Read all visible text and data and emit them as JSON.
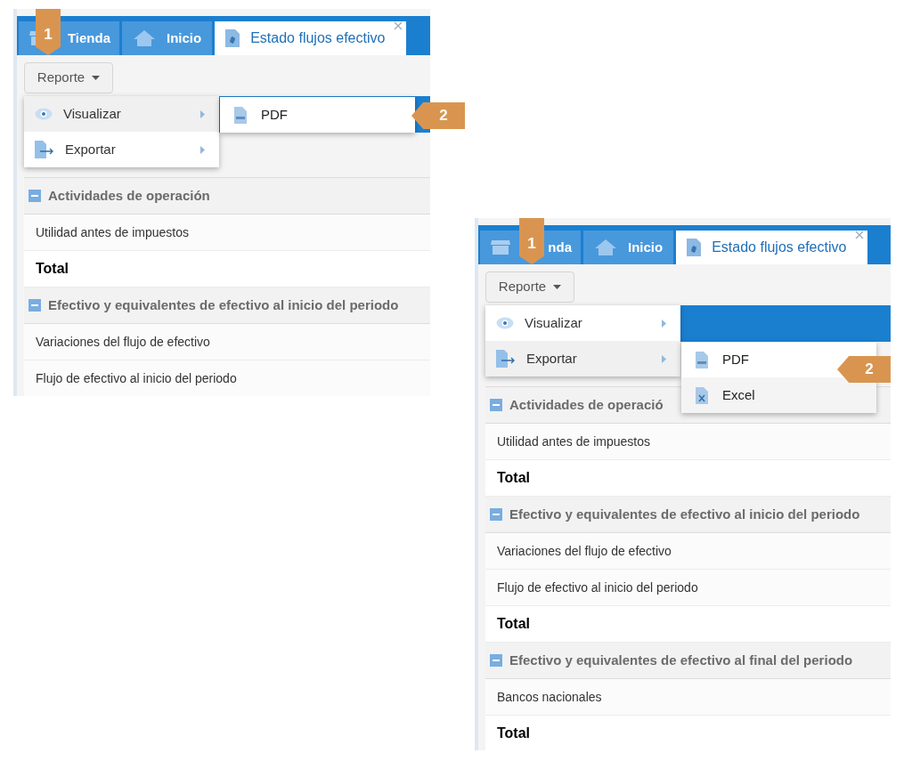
{
  "panels": [
    {
      "tabs": [
        {
          "label": "Tienda",
          "selected": false
        },
        {
          "label": "Inicio",
          "selected": false
        },
        {
          "label": "Estado flujos efectivo",
          "selected": true
        }
      ],
      "report_button": "Reporte",
      "menu": [
        {
          "label": "Visualizar",
          "selected": true,
          "submenu": [
            {
              "label": "PDF"
            }
          ]
        },
        {
          "label": "Exportar",
          "selected": false
        }
      ],
      "rows": [
        {
          "kind": "header",
          "label": "Actividades de operación"
        },
        {
          "kind": "item",
          "label": "Utilidad antes de impuestos"
        },
        {
          "kind": "total",
          "label": "Total"
        },
        {
          "kind": "header",
          "label": "Efectivo y equivalentes de efectivo al inicio del periodo"
        },
        {
          "kind": "item",
          "label": "Variaciones del flujo de efectivo"
        },
        {
          "kind": "item",
          "label": "Flujo de efectivo al inicio del periodo"
        }
      ],
      "callouts": [
        "1",
        "2"
      ]
    },
    {
      "tabs": [
        {
          "label": "nda",
          "selected": false
        },
        {
          "label": "Inicio",
          "selected": false
        },
        {
          "label": "Estado flujos efectivo",
          "selected": true
        }
      ],
      "report_button": "Reporte",
      "menu": [
        {
          "label": "Visualizar",
          "selected": false
        },
        {
          "label": "Exportar",
          "selected": true,
          "submenu": [
            {
              "label": "PDF"
            },
            {
              "label": "Excel"
            }
          ]
        }
      ],
      "rows": [
        {
          "kind": "header",
          "label": "Actividades de operació"
        },
        {
          "kind": "item",
          "label": "Utilidad antes de impuestos"
        },
        {
          "kind": "total",
          "label": "Total"
        },
        {
          "kind": "header",
          "label": "Efectivo y equivalentes de efectivo al inicio del periodo"
        },
        {
          "kind": "item",
          "label": "Variaciones del flujo de efectivo"
        },
        {
          "kind": "item",
          "label": "Flujo de efectivo al inicio del periodo"
        },
        {
          "kind": "total",
          "label": "Total"
        },
        {
          "kind": "header",
          "label": "Efectivo y equivalentes de efectivo al final del periodo"
        },
        {
          "kind": "item",
          "label": "Bancos nacionales"
        },
        {
          "kind": "total",
          "label": "Total"
        }
      ],
      "callouts": [
        "1",
        "2"
      ]
    }
  ]
}
